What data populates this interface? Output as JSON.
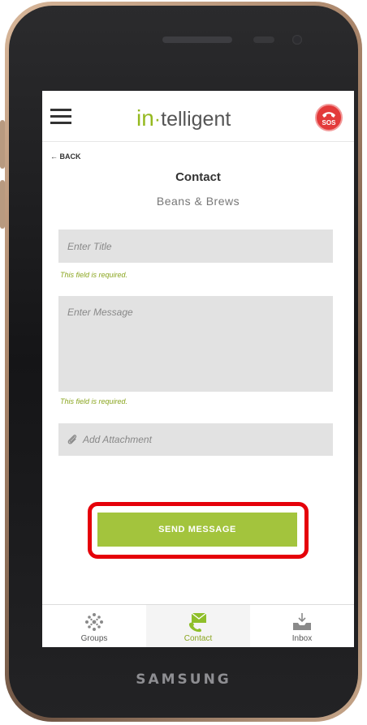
{
  "device": {
    "brand": "SAMSUNG"
  },
  "app": {
    "logo_prefix": "in",
    "logo_dot": "·",
    "logo_suffix": "telligent",
    "sos_label": "SOS",
    "accent_color": "#a3c43d",
    "sos_color": "#e33a3a"
  },
  "nav": {
    "back_label": "← BACK"
  },
  "page": {
    "title": "Contact",
    "subtitle": "Beans & Brews"
  },
  "form": {
    "title_placeholder": "Enter Title",
    "title_error": "This field is required.",
    "message_placeholder": "Enter Message",
    "message_error": "This field is required.",
    "attachment_label": "Add Attachment",
    "send_label": "SEND MESSAGE"
  },
  "bottom_nav": {
    "items": [
      {
        "label": "Groups",
        "icon": "groups-icon"
      },
      {
        "label": "Contact",
        "icon": "contact-icon",
        "active": true
      },
      {
        "label": "Inbox",
        "icon": "inbox-icon"
      }
    ]
  }
}
